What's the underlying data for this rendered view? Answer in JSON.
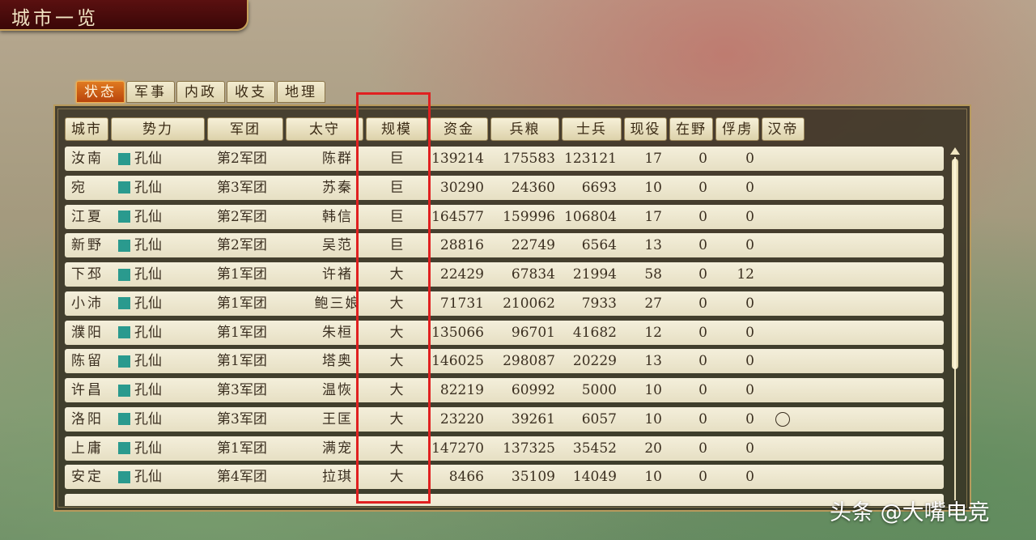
{
  "title": "城市一览",
  "tabs": [
    "状态",
    "军事",
    "内政",
    "收支",
    "地理"
  ],
  "active_tab": 0,
  "columns": [
    "城市",
    "势力",
    "军团",
    "太守",
    "规模",
    "资金",
    "兵粮",
    "士兵",
    "现役",
    "在野",
    "俘虏",
    "汉帝"
  ],
  "force_color": "#2a9a8e",
  "highlight_color": "#e02020",
  "rows": [
    {
      "city": "汝南",
      "force": "孔仙",
      "corps": "第2军团",
      "governor": "陈群",
      "scale": "巨",
      "funds": "139214",
      "food": "175583",
      "troops": "123121",
      "active": "17",
      "field": "0",
      "captive": "0",
      "emperor": ""
    },
    {
      "city": "宛",
      "force": "孔仙",
      "corps": "第3军团",
      "governor": "苏秦",
      "scale": "巨",
      "funds": "30290",
      "food": "24360",
      "troops": "6693",
      "active": "10",
      "field": "0",
      "captive": "0",
      "emperor": ""
    },
    {
      "city": "江夏",
      "force": "孔仙",
      "corps": "第2军团",
      "governor": "韩信",
      "scale": "巨",
      "funds": "164577",
      "food": "159996",
      "troops": "106804",
      "active": "17",
      "field": "0",
      "captive": "0",
      "emperor": ""
    },
    {
      "city": "新野",
      "force": "孔仙",
      "corps": "第2军团",
      "governor": "吴范",
      "scale": "巨",
      "funds": "28816",
      "food": "22749",
      "troops": "6564",
      "active": "13",
      "field": "0",
      "captive": "0",
      "emperor": ""
    },
    {
      "city": "下邳",
      "force": "孔仙",
      "corps": "第1军团",
      "governor": "许褚",
      "scale": "大",
      "funds": "22429",
      "food": "67834",
      "troops": "21994",
      "active": "58",
      "field": "0",
      "captive": "12",
      "emperor": ""
    },
    {
      "city": "小沛",
      "force": "孔仙",
      "corps": "第1军团",
      "governor": "鲍三娘",
      "scale": "大",
      "funds": "71731",
      "food": "210062",
      "troops": "7933",
      "active": "27",
      "field": "0",
      "captive": "0",
      "emperor": ""
    },
    {
      "city": "濮阳",
      "force": "孔仙",
      "corps": "第1军团",
      "governor": "朱桓",
      "scale": "大",
      "funds": "135066",
      "food": "96701",
      "troops": "41682",
      "active": "12",
      "field": "0",
      "captive": "0",
      "emperor": ""
    },
    {
      "city": "陈留",
      "force": "孔仙",
      "corps": "第1军团",
      "governor": "塔奥",
      "scale": "大",
      "funds": "146025",
      "food": "298087",
      "troops": "20229",
      "active": "13",
      "field": "0",
      "captive": "0",
      "emperor": ""
    },
    {
      "city": "许昌",
      "force": "孔仙",
      "corps": "第3军团",
      "governor": "温恢",
      "scale": "大",
      "funds": "82219",
      "food": "60992",
      "troops": "5000",
      "active": "10",
      "field": "0",
      "captive": "0",
      "emperor": ""
    },
    {
      "city": "洛阳",
      "force": "孔仙",
      "corps": "第3军团",
      "governor": "王匡",
      "scale": "大",
      "funds": "23220",
      "food": "39261",
      "troops": "6057",
      "active": "10",
      "field": "0",
      "captive": "0",
      "emperor": "○"
    },
    {
      "city": "上庸",
      "force": "孔仙",
      "corps": "第1军团",
      "governor": "满宠",
      "scale": "大",
      "funds": "147270",
      "food": "137325",
      "troops": "35452",
      "active": "20",
      "field": "0",
      "captive": "0",
      "emperor": ""
    },
    {
      "city": "安定",
      "force": "孔仙",
      "corps": "第4军团",
      "governor": "拉琪",
      "scale": "大",
      "funds": "8466",
      "food": "35109",
      "troops": "14049",
      "active": "10",
      "field": "0",
      "captive": "0",
      "emperor": ""
    }
  ],
  "watermark": "头条 @大嘴电竞"
}
